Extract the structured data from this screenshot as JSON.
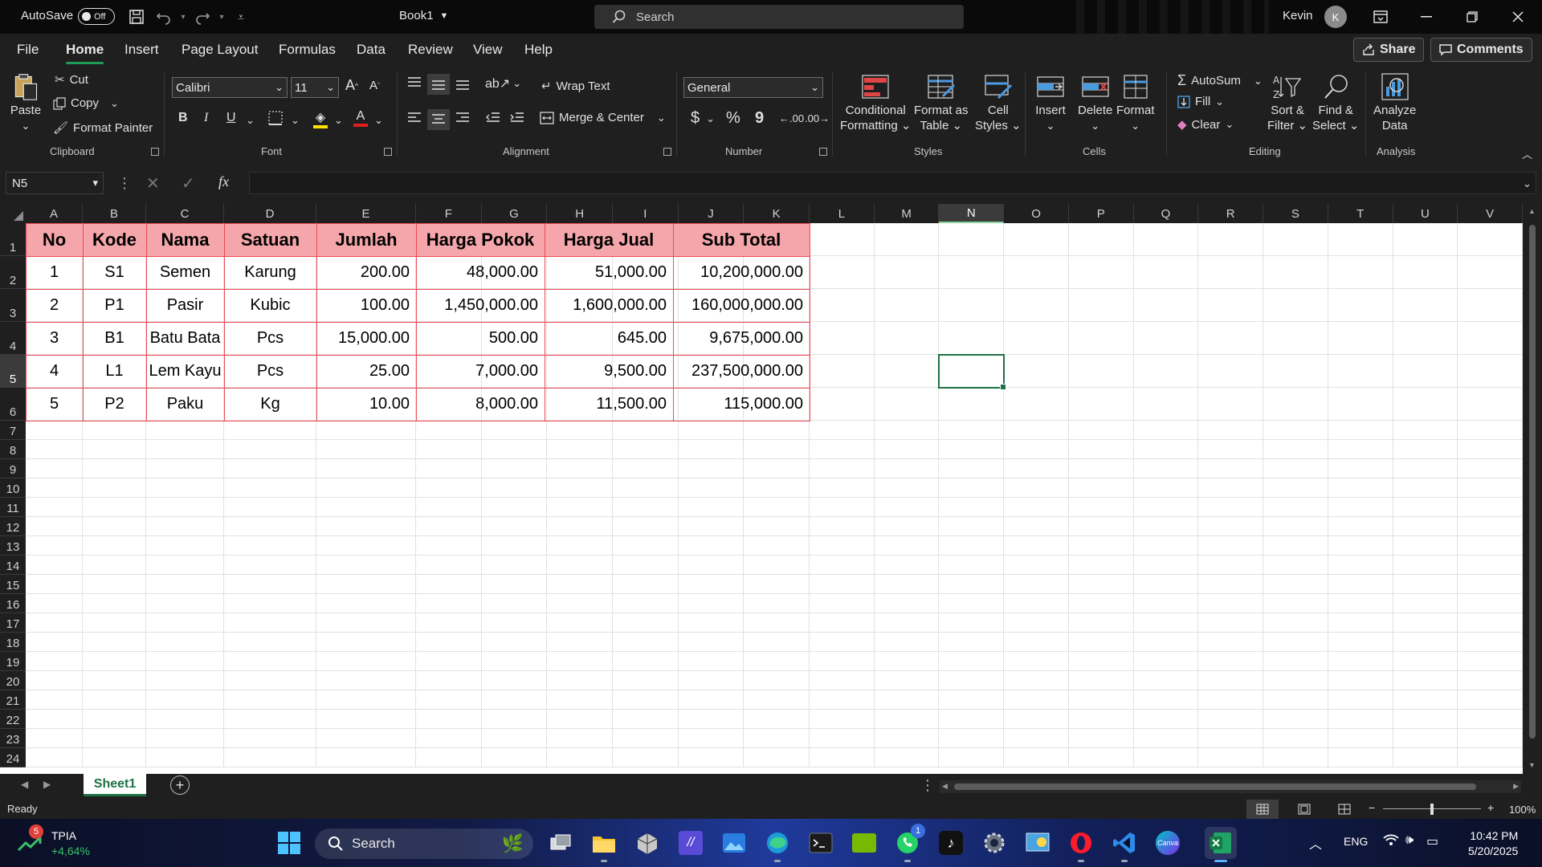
{
  "titlebar": {
    "autosave_label": "AutoSave",
    "autosave_state": "Off",
    "doc_title": "Book1",
    "search_placeholder": "Search",
    "user_name": "Kevin",
    "user_initial": "K"
  },
  "menu": {
    "tabs": [
      "File",
      "Home",
      "Insert",
      "Page Layout",
      "Formulas",
      "Data",
      "Review",
      "View",
      "Help"
    ],
    "active": "Home",
    "share": "Share",
    "comments": "Comments"
  },
  "ribbon": {
    "clipboard": {
      "paste": "Paste",
      "cut": "Cut",
      "copy": "Copy",
      "format_painter": "Format Painter",
      "label": "Clipboard"
    },
    "font": {
      "name": "Calibri",
      "size": "11",
      "label": "Font",
      "bold": "B",
      "italic": "I",
      "underline": "U"
    },
    "alignment": {
      "wrap_text": "Wrap Text",
      "merge_center": "Merge & Center",
      "label": "Alignment"
    },
    "number": {
      "format": "General",
      "currency": "$",
      "percent": "%",
      "comma": "9",
      "label": "Number"
    },
    "styles": {
      "conditional": [
        "Conditional",
        "Formatting"
      ],
      "format_table": [
        "Format as",
        "Table"
      ],
      "cell_styles": [
        "Cell",
        "Styles"
      ],
      "label": "Styles"
    },
    "cells": {
      "insert": "Insert",
      "delete": "Delete",
      "format": "Format",
      "label": "Cells"
    },
    "editing": {
      "autosum": "AutoSum",
      "fill": "Fill",
      "clear": "Clear",
      "sort_filter": [
        "Sort &",
        "Filter"
      ],
      "find_select": [
        "Find &",
        "Select"
      ],
      "label": "Editing"
    },
    "analysis": {
      "analyze": [
        "Analyze",
        "Data"
      ],
      "label": "Analysis"
    }
  },
  "formula_bar": {
    "name_box": "N5",
    "fx": "fx",
    "value": ""
  },
  "columns": [
    "A",
    "B",
    "C",
    "D",
    "E",
    "F",
    "G",
    "H",
    "I",
    "J",
    "K",
    "L",
    "M",
    "N",
    "O",
    "P",
    "Q",
    "R",
    "S",
    "T",
    "U",
    "V"
  ],
  "rows": [
    "1",
    "2",
    "3",
    "4",
    "5",
    "6",
    "7",
    "8",
    "9",
    "10",
    "11",
    "12",
    "13",
    "14",
    "15",
    "16",
    "17",
    "18",
    "19",
    "20",
    "21",
    "22",
    "23",
    "24"
  ],
  "selected_cell": {
    "col": "N",
    "row": "5"
  },
  "table": {
    "headers": [
      "No",
      "Kode",
      "Nama",
      "Satuan",
      "Jumlah",
      "Harga Pokok",
      "Harga Jual",
      "Sub Total"
    ],
    "rows": [
      [
        "1",
        "S1",
        "Semen",
        "Karung",
        "200.00",
        "48,000.00",
        "51,000.00",
        "10,200,000.00"
      ],
      [
        "2",
        "P1",
        "Pasir",
        "Kubic",
        "100.00",
        "1,450,000.00",
        "1,600,000.00",
        "160,000,000.00"
      ],
      [
        "3",
        "B1",
        "Batu Bata",
        "Pcs",
        "15,000.00",
        "500.00",
        "645.00",
        "9,675,000.00"
      ],
      [
        "4",
        "L1",
        "Lem Kayu",
        "Pcs",
        "25.00",
        "7,000.00",
        "9,500.00",
        "237,500,000.00"
      ],
      [
        "5",
        "P2",
        "Paku",
        "Kg",
        "10.00",
        "8,000.00",
        "11,500.00",
        "115,000.00"
      ]
    ]
  },
  "sheets": {
    "active": "Sheet1"
  },
  "status": {
    "ready": "Ready",
    "zoom": "100%"
  },
  "taskbar": {
    "stock_name": "TPIA",
    "stock_change": "+4,64%",
    "stock_badge": "5",
    "search": "Search",
    "whatsapp_badge": "1",
    "lang": "ENG",
    "time": "10:42 PM",
    "date": "5/20/2025"
  },
  "colors": {
    "accent": "#1e7145",
    "header_fill": "#f5a6aa",
    "table_border": "#ee4b55"
  }
}
